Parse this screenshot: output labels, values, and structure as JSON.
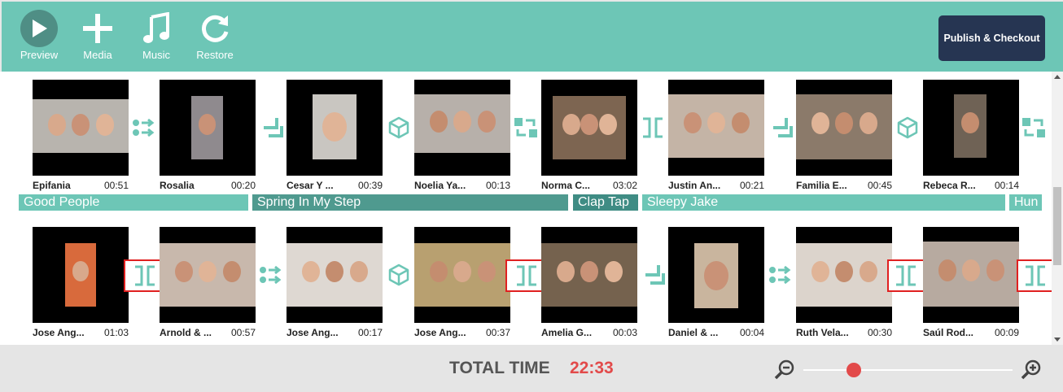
{
  "toolbar": {
    "buttons": [
      {
        "label": "Preview",
        "icon": "play-icon"
      },
      {
        "label": "Media",
        "icon": "plus-icon"
      },
      {
        "label": "Music",
        "icon": "music-note-icon"
      },
      {
        "label": "Restore",
        "icon": "restore-icon"
      }
    ],
    "publish_label": "Publish & Checkout"
  },
  "colors": {
    "accent": "#6dc6b6",
    "music_track": "#6dc6b6",
    "music_track_dark": "#4f9a8f",
    "publish_bg": "#263552",
    "total_time": "#e24a4a",
    "selection": "#e02020"
  },
  "rows": [
    {
      "clips": [
        {
          "name": "Epifania",
          "duration": "00:51",
          "transition_after": "slide-right-icon"
        },
        {
          "name": "Rosalia",
          "duration": "00:20",
          "transition_after": "corner-icon"
        },
        {
          "name": "Cesar Y ...",
          "duration": "00:39",
          "transition_after": "cube-icon"
        },
        {
          "name": "Noelia Ya...",
          "duration": "00:13",
          "transition_after": "swap-icon"
        },
        {
          "name": "Norma C...",
          "duration": "03:02",
          "transition_after": "bracket-icon"
        },
        {
          "name": "Justin An...",
          "duration": "00:21",
          "transition_after": "corner-icon"
        },
        {
          "name": "Familia E...",
          "duration": "00:45",
          "transition_after": "cube-icon"
        },
        {
          "name": "Rebeca R...",
          "duration": "00:14",
          "transition_after": "swap-icon"
        }
      ],
      "music": [
        {
          "title": "Good People",
          "tone": "light"
        },
        {
          "title": "Spring In My Step",
          "tone": "dark"
        },
        {
          "title": "Clap Tap",
          "tone": "darker"
        },
        {
          "title": "Sleepy Jake",
          "tone": "light"
        },
        {
          "title": "Hun",
          "tone": "light"
        }
      ]
    },
    {
      "clips": [
        {
          "name": "Jose Ang...",
          "duration": "01:03",
          "transition_after": "bracket-icon",
          "selected": true
        },
        {
          "name": "Arnold & ...",
          "duration": "00:57",
          "transition_after": "slide-right-icon"
        },
        {
          "name": "Jose Ang...",
          "duration": "00:17",
          "transition_after": "cube-icon"
        },
        {
          "name": "Jose Ang...",
          "duration": "00:37",
          "transition_after": "bracket-icon",
          "selected": true
        },
        {
          "name": "Amelia G...",
          "duration": "00:03",
          "transition_after": "corner-icon"
        },
        {
          "name": "Daniel & ...",
          "duration": "00:04",
          "transition_after": "slide-right-icon"
        },
        {
          "name": "Ruth Vela...",
          "duration": "00:30",
          "transition_after": "bracket-icon",
          "selected": true
        },
        {
          "name": "Saúl Rod...",
          "duration": "00:09",
          "transition_after": "bracket-icon",
          "selected": true
        }
      ]
    }
  ],
  "total": {
    "label": "TOTAL TIME",
    "value": "22:33"
  },
  "zoom": {
    "level": 0.24
  }
}
